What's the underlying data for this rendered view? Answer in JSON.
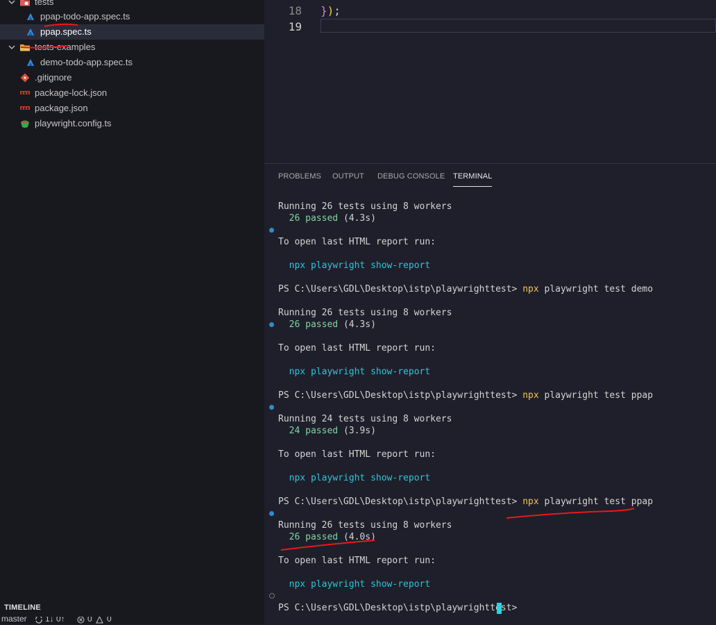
{
  "explorer": {
    "items": [
      {
        "label": "tests",
        "type": "folder"
      },
      {
        "label": "ppap-todo-app.spec.ts",
        "type": "file"
      },
      {
        "label": "ppap.spec.ts",
        "type": "file",
        "selected": true
      },
      {
        "label": "tests-examples",
        "type": "folder"
      },
      {
        "label": "demo-todo-app.spec.ts",
        "type": "file"
      },
      {
        "label": ".gitignore",
        "type": "file"
      },
      {
        "label": "package-lock.json",
        "type": "file"
      },
      {
        "label": "package.json",
        "type": "file"
      },
      {
        "label": "playwright.config.ts",
        "type": "file"
      }
    ],
    "timeline_label": "TIMELINE"
  },
  "statusbar": {
    "branch": "master",
    "sync": "1↓ 0↑",
    "errors": "0",
    "warnings": "0"
  },
  "editor": {
    "lines": [
      {
        "number": "18",
        "text": "});"
      },
      {
        "number": "19",
        "text": ""
      }
    ]
  },
  "panel": {
    "tabs": [
      "PROBLEMS",
      "OUTPUT",
      "DEBUG CONSOLE",
      "TERMINAL"
    ],
    "active_tab": "TERMINAL"
  },
  "terminal": {
    "prompt": "PS C:\\Users\\GDL\\Desktop\\istp\\playwrighttest>",
    "run1": {
      "running": "Running 26 tests using 8 workers",
      "passed": "26 passed",
      "time": "(4.3s)"
    },
    "open_report": "To open last HTML report run:",
    "npx": "npx",
    "playwright": "playwright",
    "show_report": "show-report",
    "cmd2_args": "playwright test demo",
    "run2": {
      "running": "Running 26 tests using 8 workers",
      "passed": "26 passed",
      "time": "(4.3s)"
    },
    "cmd3_args": "playwright test ppap",
    "run3": {
      "running": "Running 24 tests using 8 workers",
      "passed": "24 passed",
      "time": "(3.9s)"
    },
    "cmd4_args": "playwright test ppap",
    "run4": {
      "running": "Running 26 tests using 8 workers",
      "passed": "26 passed",
      "time": "(4.0s)"
    }
  }
}
